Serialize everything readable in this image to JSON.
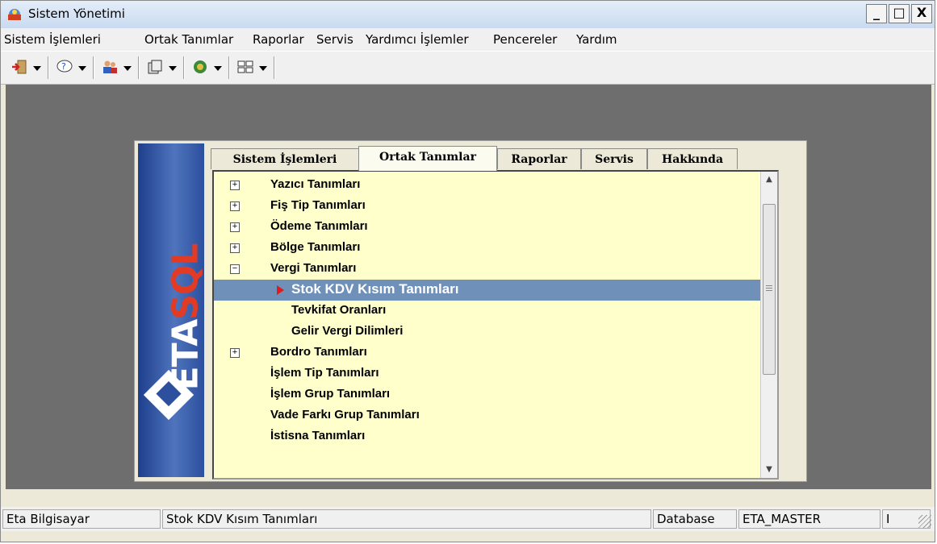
{
  "window": {
    "title": "Sistem Yönetimi",
    "controls": {
      "minimize": "_",
      "maximize": "□",
      "close": "X"
    }
  },
  "menubar": {
    "items": [
      "Sistem İşlemleri",
      "Ortak Tanımlar",
      "Raporlar",
      "Servis",
      "Yardımcı İşlemler",
      "Pencereler",
      "Yardım"
    ]
  },
  "toolbar": {
    "icons": [
      "exit-icon",
      "help-icon",
      "users-icon",
      "database-icon",
      "settings-icon",
      "windows-icon"
    ]
  },
  "dialog": {
    "logo_text": "ETA",
    "logo_text_accent": "SQL",
    "tabs": [
      "Sistem İşlemleri",
      "Ortak Tanımlar",
      "Raporlar",
      "Servis",
      "Hakkında"
    ],
    "active_tab": "Ortak Tanımlar",
    "tree": [
      {
        "label": "Yazıcı Tanımları",
        "expander": "+",
        "level": 0
      },
      {
        "label": "Fiş Tip Tanımları",
        "expander": "+",
        "level": 0
      },
      {
        "label": "Ödeme Tanımları",
        "expander": "+",
        "level": 0
      },
      {
        "label": "Bölge Tanımları",
        "expander": "+",
        "level": 0
      },
      {
        "label": "Vergi Tanımları",
        "expander": "−",
        "level": 0
      },
      {
        "label": "Stok KDV Kısım Tanımları",
        "expander": "",
        "level": 1,
        "selected": true
      },
      {
        "label": "Tevkifat Oranları",
        "expander": "",
        "level": 1
      },
      {
        "label": "Gelir Vergi Dilimleri",
        "expander": "",
        "level": 1
      },
      {
        "label": "Bordro Tanımları",
        "expander": "+",
        "level": 0
      },
      {
        "label": "İşlem Tip Tanımları",
        "expander": "",
        "level": 0
      },
      {
        "label": "İşlem Grup Tanımları",
        "expander": "",
        "level": 0
      },
      {
        "label": "Vade Farkı Grup Tanımları",
        "expander": "",
        "level": 0
      },
      {
        "label": "İstisna Tanımları",
        "expander": "",
        "level": 0
      }
    ]
  },
  "statusbar": {
    "company": "Eta Bilgisayar",
    "selection": "Stok KDV Kısım Tanımları",
    "db_label": "Database",
    "db_value": "ETA_MASTER",
    "extra": "I"
  },
  "colors": {
    "selection": "#6f90b8",
    "tree_background": "#ffffcc",
    "mdi_background": "#6e6e6e",
    "arrow": "#e01b1b"
  }
}
